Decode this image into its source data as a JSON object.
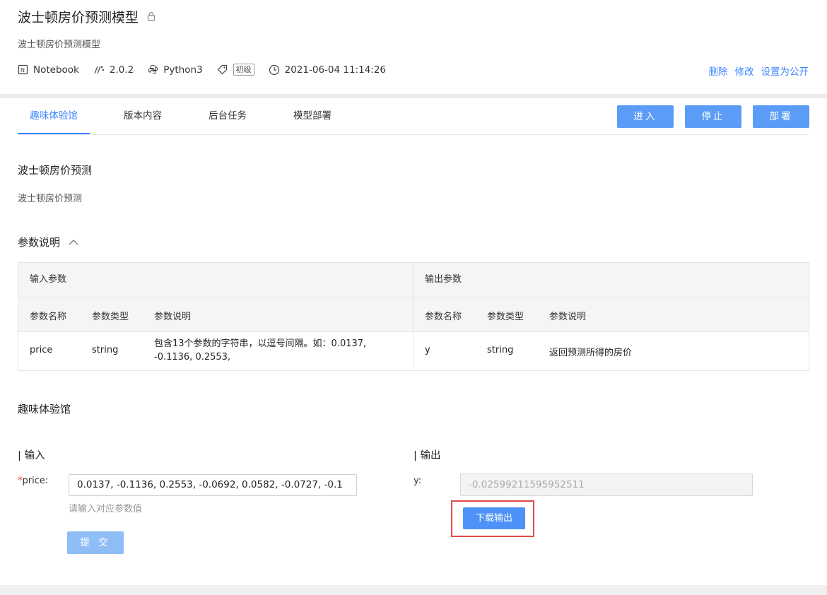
{
  "header": {
    "title": "波士顿房价预测模型",
    "subtitle": "波士顿房价预测模型",
    "meta": {
      "type": "Notebook",
      "version": "2.0.2",
      "language": "Python3",
      "level": "初级",
      "datetime": "2021-06-04 11:14:26"
    },
    "actions": {
      "delete": "删除",
      "edit": "修改",
      "make_public": "设置为公开"
    }
  },
  "tabs": [
    "趣味体验馆",
    "版本内容",
    "后台任务",
    "模型部署"
  ],
  "buttons": {
    "enter": "进入",
    "stop": "停止",
    "deploy": "部署"
  },
  "intro": {
    "heading": "波士顿房价预测",
    "description": "波士顿房价预测"
  },
  "params": {
    "heading": "参数说明",
    "input_title": "输入参数",
    "output_title": "输出参数",
    "columns": [
      "参数名称",
      "参数类型",
      "参数说明"
    ],
    "input_rows": [
      {
        "name": "price",
        "type": "string",
        "desc": "包含13个参数的字符串，以逗号间隔。如：0.0137, -0.1136, 0.2553,"
      }
    ],
    "output_rows": [
      {
        "name": "y",
        "type": "string",
        "desc": "返回预测所得的房价"
      }
    ]
  },
  "playground": {
    "heading": "趣味体验馆",
    "input_title": "| 输入",
    "output_title": "| 输出",
    "input_label": "price:",
    "input_required_mark": "*",
    "input_value": "0.0137, -0.1136, 0.2553, -0.0692, 0.0582, -0.0727, -0.1",
    "input_hint": "请输入对应参数值",
    "submit_label": "提 交",
    "output_label": "y:",
    "output_value": "-0.02599211595952511",
    "download_label": "下载输出"
  },
  "colors": {
    "accent": "#3b86ff",
    "button": "#5b9cf8",
    "highlight": "#e14b4b"
  }
}
